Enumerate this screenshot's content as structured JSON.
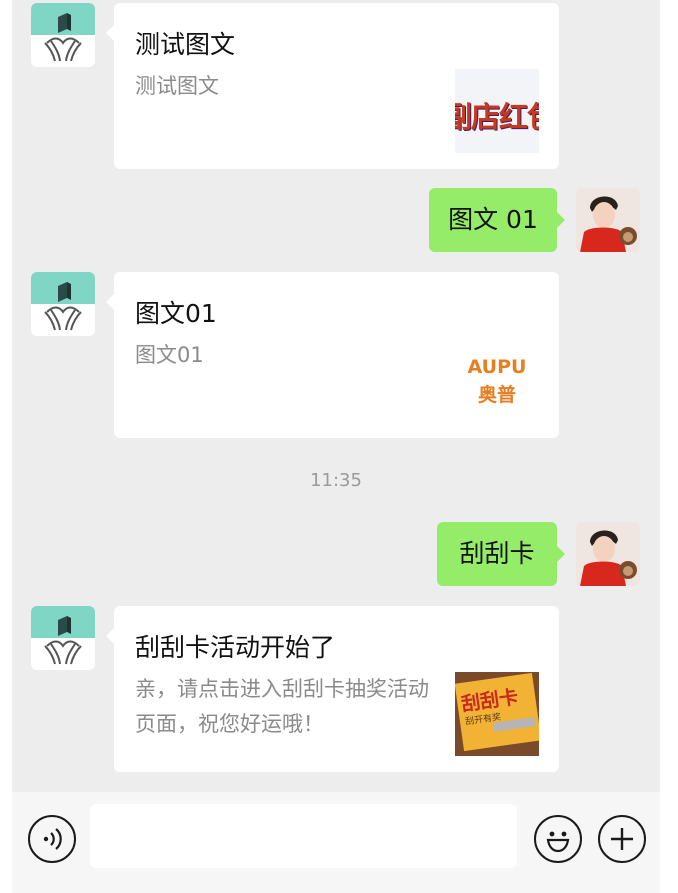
{
  "messages": [
    {
      "type": "card",
      "sender": "bot",
      "title": "测试图文",
      "desc": "测试图文",
      "thumb_text": "副店红包"
    },
    {
      "type": "bubble",
      "sender": "user",
      "text": "图文 01"
    },
    {
      "type": "card",
      "sender": "bot",
      "title": "图文01",
      "desc": "图文01",
      "thumb_brand_en": "AUPU",
      "thumb_brand_cn": "奥普"
    },
    {
      "type": "timestamp",
      "text": "11:35"
    },
    {
      "type": "bubble",
      "sender": "user",
      "text": "刮刮卡"
    },
    {
      "type": "card",
      "sender": "bot",
      "title": "刮刮卡活动开始了",
      "desc": "亲，请点击进入刮刮卡抽奖活动页面，祝您好运哦！",
      "thumb_text": "刮刮卡",
      "thumb_subtext": "刮开有奖"
    }
  ],
  "input": {
    "placeholder": ""
  },
  "icons": {
    "voice": "voice-icon",
    "emoji": "emoji-icon",
    "add": "plus-icon"
  },
  "colors": {
    "chat_bg": "#ededed",
    "user_bubble": "#95ec69",
    "bot_avatar_teal": "#7fd6c4"
  }
}
